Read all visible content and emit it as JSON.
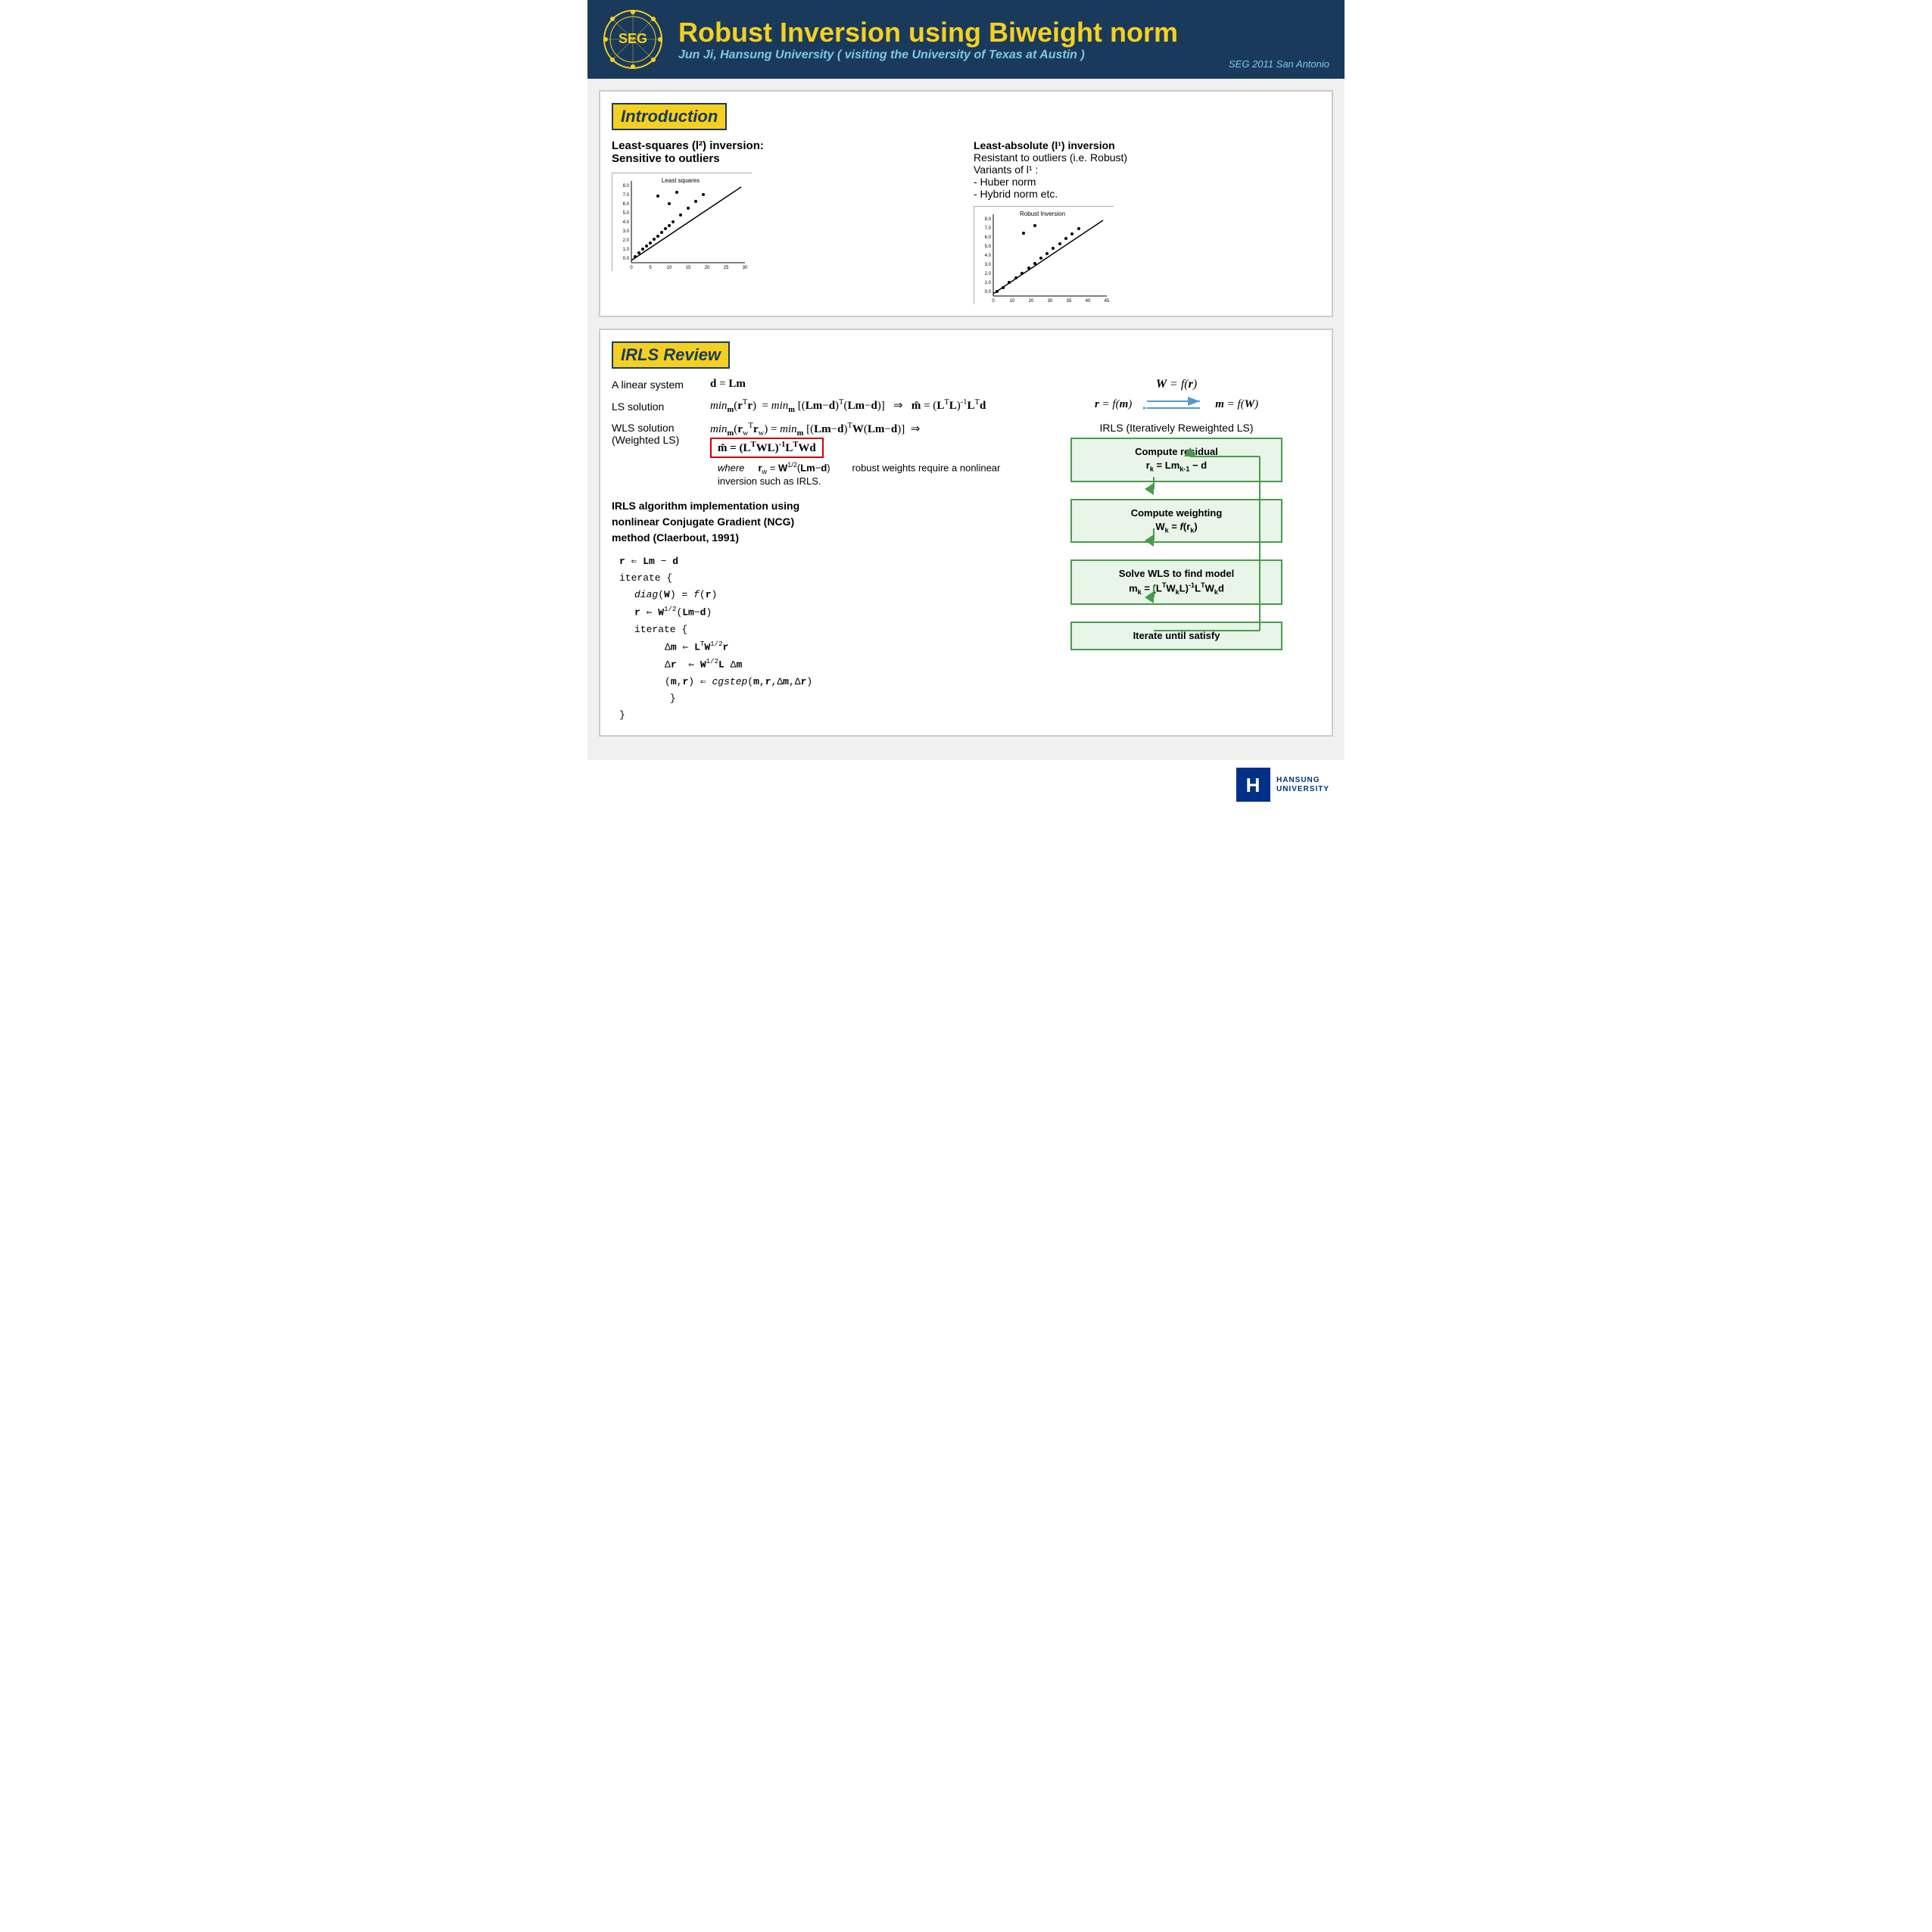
{
  "header": {
    "title": "Robust Inversion using Biweight norm",
    "subtitle": "Jun Ji, Hansung University ( visiting the University of Texas at Austin )",
    "location": "SEG 2011 San Antonio",
    "logo_text": "SEG"
  },
  "intro": {
    "section_title": "Introduction",
    "left_text_line1": "Least-squares (l²) inversion:",
    "left_text_line2": "Sensitive to outliers",
    "chart1_title": "Least squares",
    "right_text_line1": "Least-absolute (l¹) inversion",
    "right_text_line2": "Resistant to outliers (i.e. Robust)",
    "right_text_line3": "Variants of l¹ :",
    "right_text_line4": "- Huber norm",
    "right_text_line5": "- Hybrid norm etc.",
    "chart2_title": "Robust Inversion"
  },
  "irls": {
    "section_title": "IRLS Review",
    "linear_system_label": "A linear system",
    "ls_solution_label": "LS solution",
    "wls_solution_label": "WLS solution",
    "weighted_ls_label": "(Weighted LS)",
    "where_label": "where",
    "robust_note": "robust weights require a nonlinear inversion such as IRLS.",
    "algo_title_line1": "IRLS algorithm implementation using",
    "algo_title_line2": "nonlinear Conjugate Gradient (NCG)",
    "algo_title_line3": "method (Claerbout, 1991)",
    "irls_cycle_label": "IRLS (Iteratively Reweighted LS)",
    "flow1_line1": "Compute residual",
    "flow1_line2": "r_k = Lm_{k-1} - d",
    "flow2_line1": "Compute weighting",
    "flow2_line2": "W_k = f(r_k)",
    "flow3_line1": "Solve WLS to find model",
    "flow3_line2": "m_k = (L^T W_k L)^{-1} L^T W_k d",
    "flow4_label": "Iterate until satisfy"
  }
}
